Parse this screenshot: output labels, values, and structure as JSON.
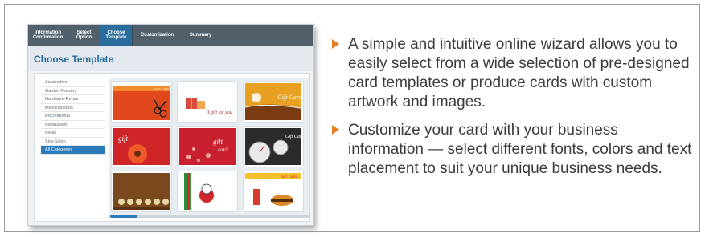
{
  "wizard": {
    "tabs": [
      {
        "label": "Information Confirmation"
      },
      {
        "label": "Select Option"
      },
      {
        "label": "Choose Template"
      },
      {
        "label": "Customization"
      },
      {
        "label": "Summary"
      }
    ],
    "title": "Choose Template",
    "categories": [
      "Automotive",
      "Garden-Nursery",
      "Hardware-Repair",
      "Miscellaneous",
      "Recreational",
      "Restaurant",
      "Retail",
      "Spa-Salon",
      "All Categories"
    ],
    "selected_category": "All Categories",
    "card_texts": {
      "gift_card": "GIFT CARD",
      "a_gift_for_you": "A gift for you",
      "gift_card_script": "Gift Card",
      "gift_card_split_top": "gift",
      "gift_card_split_bottom": "card"
    }
  },
  "bullets": [
    "A simple and intuitive online wizard allows you to easily select from a wide selection of pre-designed card templates or produce cards with custom artwork and images.",
    "Customize your card with your business information — select different fonts, colors and text placement to suit your unique business needs."
  ],
  "colors": {
    "accent": "#2a79b8",
    "bullet_arrow": "#e67e22",
    "tab_bar": "#52606b"
  }
}
